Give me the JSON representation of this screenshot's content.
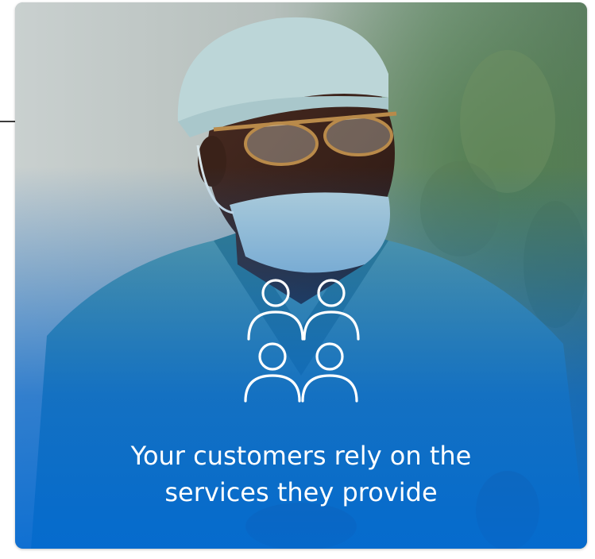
{
  "card": {
    "headline_line1": "Your customers rely on the",
    "headline_line2": "services they provide",
    "icon": "people-group-icon",
    "accent_color": "#0068D2"
  }
}
